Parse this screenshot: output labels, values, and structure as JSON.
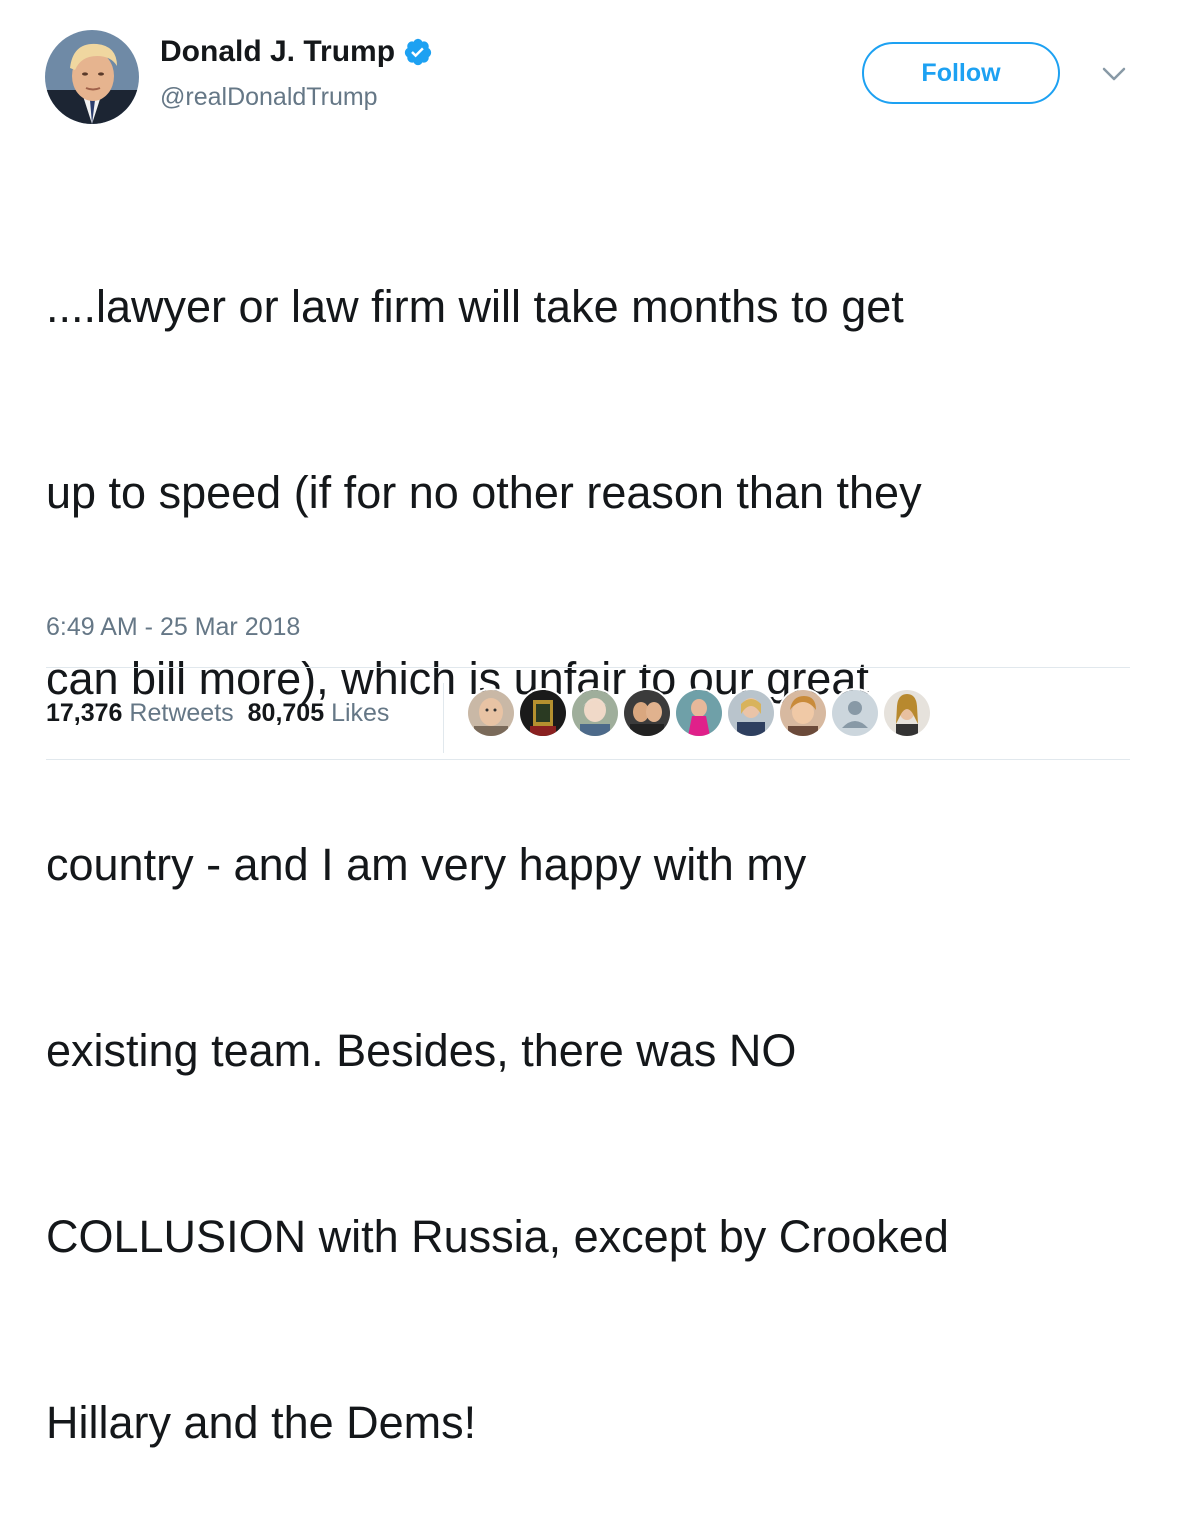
{
  "author": {
    "display_name": "Donald J. Trump",
    "handle": "@realDonaldTrump",
    "verified": true,
    "verified_icon": "verified-badge-icon",
    "verified_color": "#1da1f2"
  },
  "actions": {
    "follow_label": "Follow",
    "more_icon": "chevron-down-icon"
  },
  "tweet": {
    "lines": [
      "....lawyer or law firm will take months to get",
      "up to speed (if for no other reason than they",
      "can bill more), which is unfair to our great",
      "country - and I am very happy with my",
      "existing team. Besides, there was NO",
      "COLLUSION with Russia, except by Crooked",
      "Hillary and the Dems!"
    ],
    "timestamp": "6:49 AM - 25 Mar 2018"
  },
  "stats": {
    "retweets_count": "17,376",
    "retweets_label": "Retweets",
    "likes_count": "80,705",
    "likes_label": "Likes"
  },
  "colors": {
    "accent": "#1da1f2",
    "text_primary": "#14171a",
    "text_secondary": "#657786",
    "divider": "#e1e8ed"
  }
}
